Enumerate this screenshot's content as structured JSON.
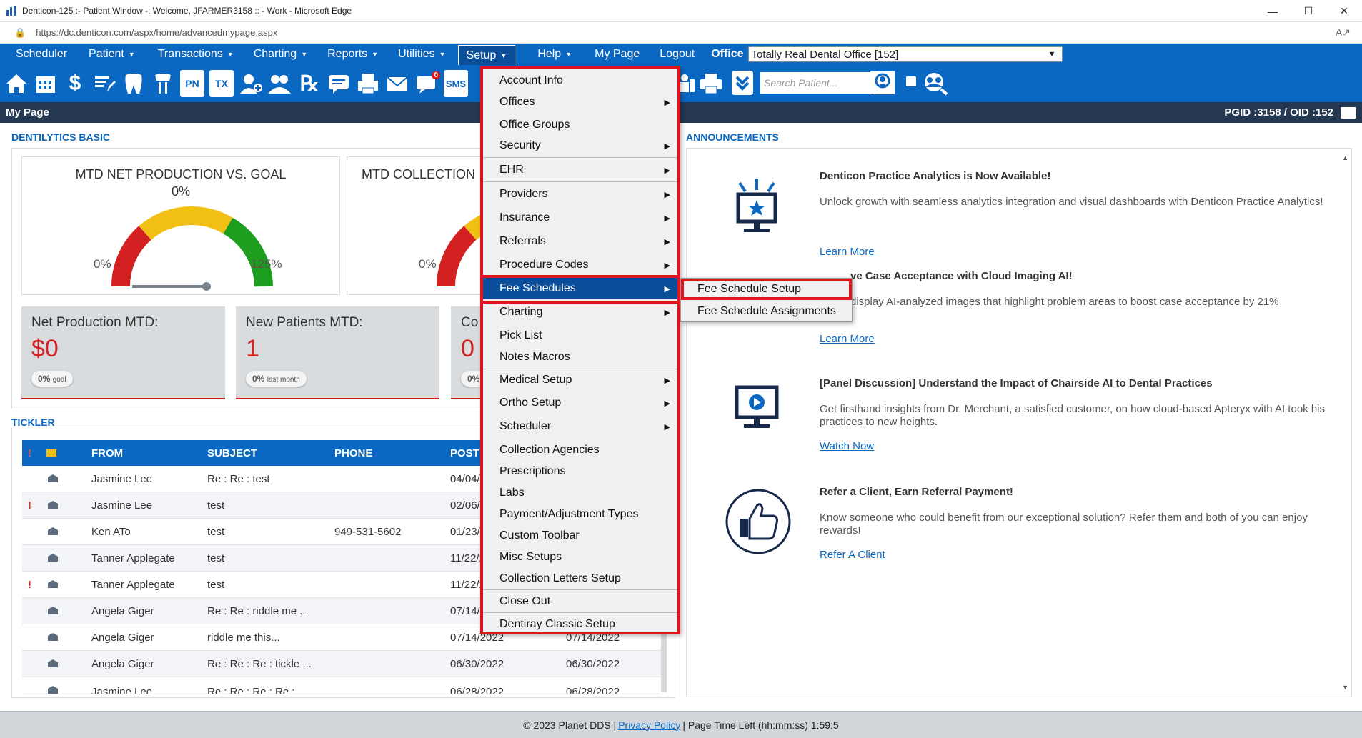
{
  "window": {
    "title": "Denticon-125 :- Patient Window -: Welcome, JFARMER3158 :: - Work - Microsoft Edge",
    "url": "https://dc.denticon.com/aspx/home/advancedmypage.aspx"
  },
  "nav": {
    "items": [
      "Scheduler",
      "Patient",
      "Transactions",
      "Charting",
      "Reports",
      "Utilities",
      "Setup",
      "Help",
      "My Page",
      "Logout"
    ],
    "office_label": "Office",
    "office_value": "Totally Real Dental Office [152]"
  },
  "toolbar": {
    "search_placeholder": "Search Patient...",
    "sms_label": "SMS",
    "badge_count": "0",
    "pn_label": "PN",
    "tx_label": "TX"
  },
  "mypage": {
    "title": "My Page",
    "ids": "PGID :3158  /  OID :152"
  },
  "dentilytics": {
    "section_title": "DENTILYTICS BASIC",
    "gauge1": {
      "title": "MTD NET PRODUCTION VS. GOAL",
      "value": "0%",
      "min": "0%",
      "max": "125%"
    },
    "gauge2": {
      "title": "MTD COLLECTION",
      "min": "0%"
    },
    "kpi1": {
      "label": "Net Production MTD:",
      "value": "$0",
      "badge_value": "0%",
      "badge_text": "goal"
    },
    "kpi2": {
      "label": "New Patients MTD:",
      "value": "1",
      "badge_value": "0%",
      "badge_text": "last month"
    },
    "kpi3": {
      "label": "Co",
      "value": "0",
      "badge_value": "0%"
    }
  },
  "tickler": {
    "section_title": "TICKLER",
    "columns": [
      "!",
      "FROM",
      "SUBJECT",
      "PHONE",
      "POST D"
    ],
    "rows": [
      {
        "flag": "",
        "from": "Jasmine Lee",
        "subject": "Re : Re : test",
        "phone": "",
        "post": "04/04/2"
      },
      {
        "flag": "!",
        "from": "Jasmine Lee",
        "subject": "test",
        "phone": "",
        "post": "02/06/2"
      },
      {
        "flag": "",
        "from": "Ken ATo",
        "subject": "test",
        "phone": "949-531-5602",
        "post": "01/23/20"
      },
      {
        "flag": "",
        "from": "Tanner Applegate",
        "subject": "test",
        "phone": "",
        "post": "11/22/20"
      },
      {
        "flag": "!",
        "from": "Tanner Applegate",
        "subject": "test",
        "phone": "",
        "post": "11/22/20"
      },
      {
        "flag": "",
        "from": "Angela Giger",
        "subject": "Re : Re : riddle me ...",
        "phone": "",
        "post": "07/14/20"
      },
      {
        "flag": "",
        "from": "Angela Giger",
        "subject": "riddle me this...",
        "phone": "",
        "post": "07/14/2022",
        "due": "07/14/2022"
      },
      {
        "flag": "",
        "from": "Angela Giger",
        "subject": "Re : Re : Re : tickle ...",
        "phone": "",
        "post": "06/30/2022",
        "due": "06/30/2022"
      },
      {
        "flag": "",
        "from": "Jasmine Lee",
        "subject": "Re : Re : Re : Re :",
        "phone": "",
        "post": "06/28/2022",
        "due": "06/28/2022"
      }
    ]
  },
  "announcements": {
    "section_title": "ANNOUNCEMENTS",
    "items": [
      {
        "title": "Denticon Practice Analytics is Now Available!",
        "body": "Unlock growth with seamless analytics integration and visual dashboards with Denticon Practice Analytics!",
        "link": "Learn More"
      },
      {
        "title": "ve Case Acceptance with Cloud Imaging AI!",
        "body": "display AI-analyzed images that highlight problem areas to boost case acceptance by 21%",
        "link": "Learn More"
      },
      {
        "title": "[Panel Discussion] Understand the Impact of Chairside AI to Dental Practices",
        "body": "Get firsthand insights from Dr. Merchant, a satisfied customer, on how cloud-based Apteryx with AI took his practices to new heights.",
        "link": "Watch Now"
      },
      {
        "title": "Refer a Client, Earn Referral Payment!",
        "body": "Know someone who could benefit from our exceptional solution? Refer them and both of you can enjoy rewards!",
        "link": "Refer A Client"
      }
    ]
  },
  "setup_menu": {
    "items": [
      {
        "label": "Account Info",
        "sub": false
      },
      {
        "label": "Offices",
        "sub": true
      },
      {
        "label": "Office Groups",
        "sub": false
      },
      {
        "label": "Security",
        "sub": true
      },
      {
        "label": "EHR",
        "sub": true
      },
      {
        "label": "Providers",
        "sub": true
      },
      {
        "label": "Insurance",
        "sub": true
      },
      {
        "label": "Referrals",
        "sub": true
      },
      {
        "label": "Procedure Codes",
        "sub": true
      },
      {
        "label": "Fee Schedules",
        "sub": true
      },
      {
        "label": "Charting",
        "sub": true
      },
      {
        "label": "Pick List",
        "sub": false
      },
      {
        "label": "Notes Macros",
        "sub": false
      },
      {
        "label": "Medical Setup",
        "sub": true
      },
      {
        "label": "Ortho Setup",
        "sub": true
      },
      {
        "label": "Scheduler",
        "sub": true
      },
      {
        "label": "Collection Agencies",
        "sub": false
      },
      {
        "label": "Prescriptions",
        "sub": false
      },
      {
        "label": "Labs",
        "sub": false
      },
      {
        "label": "Payment/Adjustment Types",
        "sub": false
      },
      {
        "label": "Custom Toolbar",
        "sub": false
      },
      {
        "label": "Misc Setups",
        "sub": false
      },
      {
        "label": "Collection Letters Setup",
        "sub": false
      },
      {
        "label": "Close Out",
        "sub": false
      },
      {
        "label": "Dentiray Classic Setup",
        "sub": false
      }
    ],
    "fee_submenu": [
      "Fee Schedule Setup",
      "Fee Schedule Assignments"
    ]
  },
  "footer": {
    "copyright": "© 2023 Planet DDS |",
    "privacy": "Privacy Policy",
    "time_left": "| Page Time Left (hh:mm:ss) 1:59:5"
  },
  "colors": {
    "brand_blue": "#0a67c2",
    "highlight_red": "#e0141e",
    "dark_bar": "#243851"
  }
}
